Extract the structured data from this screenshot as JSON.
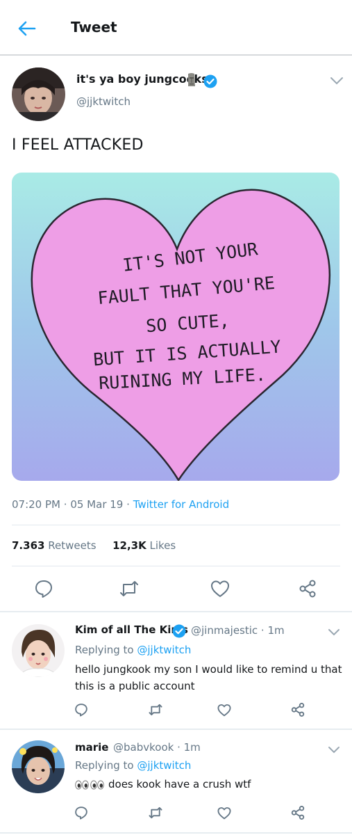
{
  "header": {
    "title": "Tweet"
  },
  "tweet": {
    "author_name": "it's ya boy jungcooks",
    "author_handle": "@jjktwitch",
    "text": "I FEEL ATTACKED",
    "image_text": [
      "IT'S NOT YOUR",
      "FAULT THAT YOU'RE",
      "SO CUTE,",
      "BUT IT IS ACTUALLY",
      "RUINING MY LIFE."
    ],
    "time": "07:20 PM",
    "date": "05 Mar 19",
    "source": "Twitter for Android",
    "sep": "·",
    "retweets_count": "7.363",
    "retweets_label": "Retweets",
    "likes_count": "12,3K",
    "likes_label": "Likes"
  },
  "replies": [
    {
      "name": "Kim of all The Kims",
      "handle": "@jinmajestic · 1m",
      "replying_prefix": "Replying to",
      "replying_to": "@jjktwitch",
      "text": "hello jungkook my son I would like to remind u that this is a public account"
    },
    {
      "name": "marie",
      "handle": "@babvkook · 1m",
      "replying_prefix": "Replying to",
      "replying_to": "@jjktwitch",
      "text": "does kook have a crush wtf"
    }
  ],
  "colors": {
    "accent": "#1da1f2",
    "muted": "#657786",
    "text": "#14171a",
    "heart_fill": "#ee9ee6"
  },
  "icons": [
    "back-arrow-icon",
    "verified-badge-icon",
    "moai-emoji-icon",
    "chevron-down-icon",
    "reply-icon",
    "retweet-icon",
    "like-icon",
    "share-icon",
    "eyes-emoji-icon"
  ]
}
